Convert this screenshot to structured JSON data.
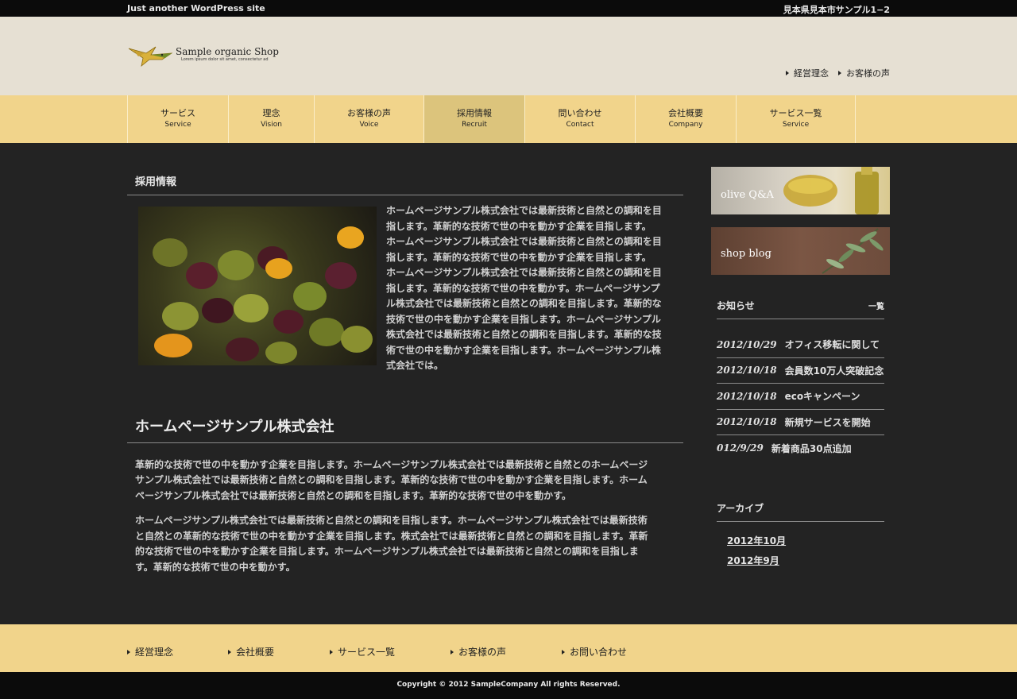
{
  "topbar": {
    "tagline": "Just another WordPress site",
    "address": "見本県見本市サンプル1−2"
  },
  "logo": {
    "name": "Sample organic Shop",
    "sub": "Lorem ipsum dolor sit amet, consectetur ad"
  },
  "header_links": [
    "経営理念",
    "お客様の声"
  ],
  "nav": [
    {
      "ja": "サービス",
      "en": "Service"
    },
    {
      "ja": "理念",
      "en": "Vision"
    },
    {
      "ja": "お客様の声",
      "en": "Voice"
    },
    {
      "ja": "採用情報",
      "en": "Recruit",
      "active": true
    },
    {
      "ja": "問い合わせ",
      "en": "Contact"
    },
    {
      "ja": "会社概要",
      "en": "Company"
    },
    {
      "ja": "サービス一覧",
      "en": "Service"
    }
  ],
  "main": {
    "heading": "採用情報",
    "intro_lines": [
      "ホームページサンプル株式会社では最新技術と自然との調和を目",
      "指します。革新的な技術で世の中を動かす企業を目指します。",
      "ホームページサンプル株式会社では最新技術と自然との調和を目",
      "指します。革新的な技術で世の中を動かす企業を目指します。",
      "ホームページサンプル株式会社では最新技術と自然との調和を目",
      "指します。革新的な技術で世の中を動かす。ホームページサンプ",
      "ル株式会社では最新技術と自然との調和を目指します。革新的な",
      "技術で世の中を動かす企業を目指します。ホームページサンプル",
      "株式会社では最新技術と自然との調和を目指します。革新的な技",
      "術で世の中を動かす企業を目指します。ホームページサンプル株",
      "式会社では。"
    ],
    "company_heading": "ホームページサンプル株式会社",
    "para1_lines": [
      "革新的な技術で世の中を動かす企業を目指します。ホームページサンプル株式会社では最新技術と自然とのホームページ",
      "サンプル株式会社では最新技術と自然との調和を目指します。革新的な技術で世の中を動かす企業を目指します。ホーム",
      "ページサンプル株式会社では最新技術と自然との調和を目指します。革新的な技術で世の中を動かす。"
    ],
    "para2_lines": [
      "ホームページサンプル株式会社では最新技術と自然との調和を目指します。ホームページサンプル株式会社では最新技術",
      "と自然との革新的な技術で世の中を動かす企業を目指します。株式会社では最新技術と自然との調和を目指します。革新",
      "的な技術で世の中を動かす企業を目指します。ホームページサンプル株式会社では最新技術と自然との調和を目指しま",
      "す。革新的な技術で世の中を動かす。"
    ]
  },
  "sidebar": {
    "banner1": "olive Q&A",
    "banner2": "shop blog",
    "news_title": "お知らせ",
    "news_more": "一覧",
    "news": [
      {
        "date": "2012/10/29",
        "title": "オフィス移転に関して"
      },
      {
        "date": "2012/10/18",
        "title": "会員数10万人突破記念"
      },
      {
        "date": "2012/10/18",
        "title": "ecoキャンペーン"
      },
      {
        "date": "2012/10/18",
        "title": "新規サービスを開始"
      },
      {
        "date": "012/9/29",
        "title": "新着商品30点追加"
      }
    ],
    "archive_title": "アーカイブ",
    "archives": [
      "2012年10月",
      "2012年9月"
    ]
  },
  "footer": {
    "links": [
      "経営理念",
      "会社概要",
      "サービス一覧",
      "お客様の声",
      "お問い合わせ"
    ],
    "copyright": "Copyright © 2012 SampleCompany All rights Reserved."
  },
  "colors": {
    "nav_bg": "#f1d48b",
    "nav_active": "#dcc47c",
    "header_bg": "#e6e0d3",
    "body_bg": "#232323"
  }
}
